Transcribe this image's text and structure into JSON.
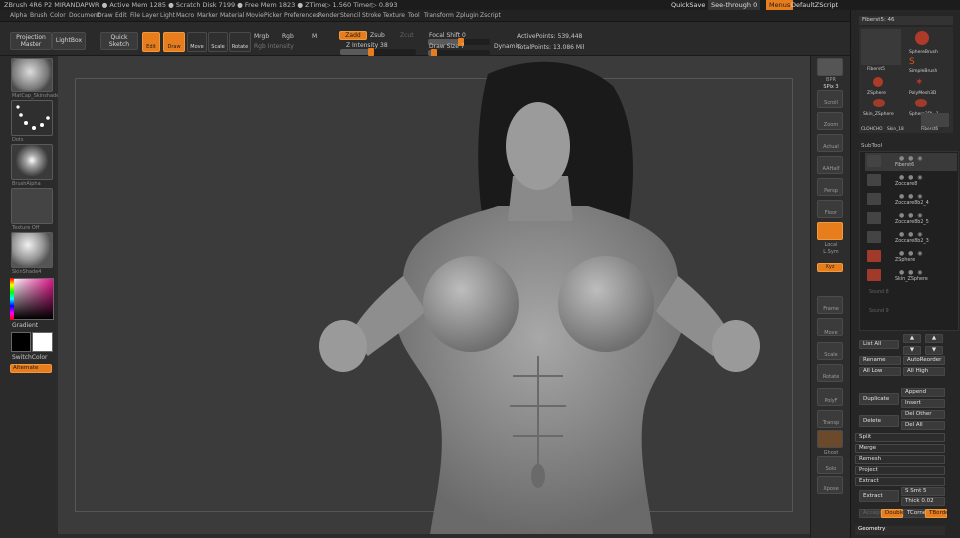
{
  "titlebar": {
    "title": "ZBrush 4R6 P2   MIRANDAPWR   ● Active Mem 1285 ● Scratch Disk 7199 ● Free Mem 1823 ● ZTime▷ 1.560 Timer▷ 0.893",
    "quicksave": "QuickSave",
    "seethrough": "See-through  0",
    "menus_btn": "Menus",
    "script": "DefaultZScript"
  },
  "menubar": [
    "Alpha",
    "Brush",
    "Color",
    "Document",
    "Draw",
    "Edit",
    "File",
    "Layer",
    "Light",
    "Macro",
    "Marker",
    "Material",
    "Movie",
    "Picker",
    "Preferences",
    "Render",
    "Stencil",
    "Stroke",
    "Texture",
    "Tool",
    "Transform",
    "Zplugin",
    "Zscript"
  ],
  "shelf": {
    "projection_master": "Projection Master",
    "lightbox": "LightBox",
    "quick_sketch": "Quick Sketch",
    "edit": "Edit",
    "draw": "Draw",
    "move": "Move",
    "scale": "Scale",
    "rotate": "Rotate",
    "mrgb": "Mrgb",
    "rgb": "Rgb",
    "m": "M",
    "zadd": "Zadd",
    "zsub": "Zsub",
    "zcut": "Zcut",
    "rgb_intensity": "Rgb Intensity",
    "z_intensity": "Z Intensity 38",
    "focal_shift": "Focal Shift 0",
    "draw_size": "Draw Size 7",
    "dynamic": "Dynamic",
    "active_points": "ActivePoints: 539,448",
    "total_points": "TotalPoints: 13.086 Mil"
  },
  "lefttray": {
    "material": "MatCap_Skinshade4",
    "stroke": "Dots",
    "alpha": "BrushAlpha",
    "texture": "Texture Off",
    "material2": "SkinShade4",
    "gradient": "Gradient",
    "switchcolor": "SwitchColor",
    "alternate": "Alternate"
  },
  "rshelf": [
    "BPR",
    "SPix 3",
    "Scroll",
    "Zoom",
    "Actual",
    "AAHalf",
    "Persp",
    "Floor",
    "Local",
    "L.Sym",
    "Xyz",
    "Frame",
    "Move",
    "Scale",
    "Rotate",
    "PolyF",
    "Transp",
    "Ghost",
    "Solo",
    "Xpose"
  ],
  "rpanel": {
    "tool_name": "Fiberst5: 46",
    "tools": [
      "Fiberst5",
      "SphereBrush",
      "SimpleBrush",
      "ZSphere",
      "PolyMesh3D",
      "Skin_ZSphere",
      "Sphere3DL_1",
      "CLOHCHO",
      "Skin_18",
      "Fiberst6"
    ],
    "subtool_header": "SubTool",
    "subtools": [
      "Fiberst6",
      "Zoccare8",
      "Zoccare8b2_4",
      "Zoccare8b2_5",
      "Zoccare8b2_3",
      "ZSphere",
      "Skin_ZSphere",
      "Sound 8",
      "Sound 9"
    ],
    "list_all": "List All",
    "rename": "Rename",
    "autoreorder": "AutoReorder",
    "all_low": "All Low",
    "all_high": "All High",
    "duplicate": "Duplicate",
    "append": "Append",
    "insert": "Insert",
    "delete": "Delete",
    "del_other": "Del Other",
    "del_all": "Del All",
    "split": "Split",
    "merge": "Merge",
    "remesh": "Remesh",
    "project": "Project",
    "extract_section": "Extract",
    "extract_btn": "Extract",
    "s_smt": "S Smt 5",
    "thick": "Thick 0.02",
    "accept": "Accept",
    "double": "Double",
    "tcorne": "TCorne",
    "tborder": "TBorde",
    "geometry": "Geometry"
  },
  "colors": {
    "accent": "#e87d1e",
    "panel": "#262626",
    "canvas": "#3b3b3b"
  }
}
